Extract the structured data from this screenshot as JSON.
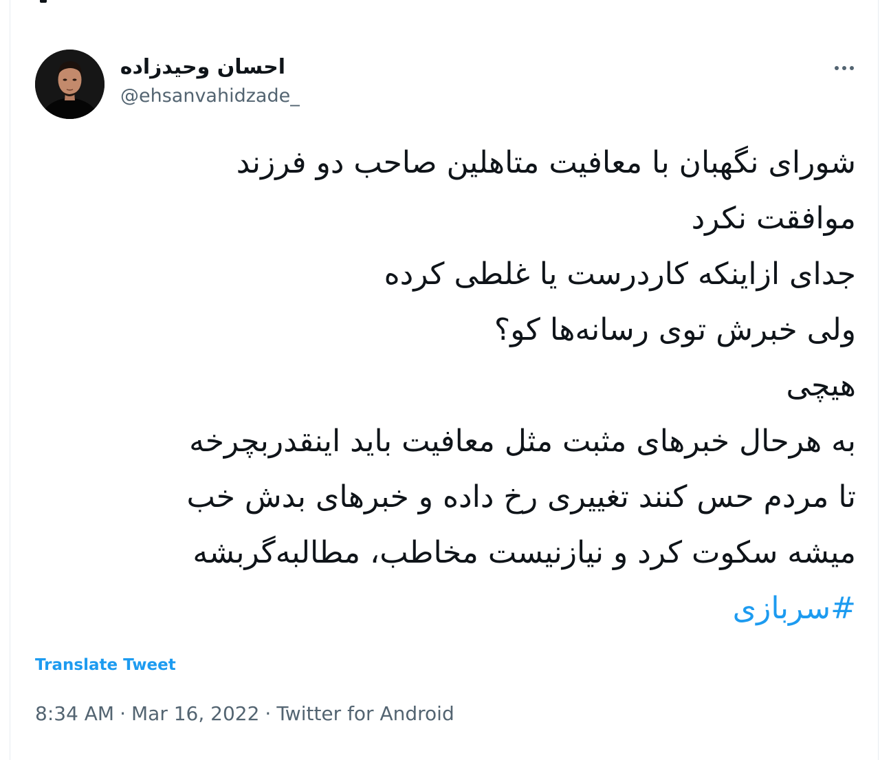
{
  "tweet": {
    "author": {
      "display_name": "احسان وحیدزاده",
      "handle": "@ehsanvahidzade_"
    },
    "more_icon": "more-horizontal-icon",
    "lines": [
      "شورای نگهبان با معافیت متاهلین صاحب دو فرزند",
      "موافقت نکرد",
      "جدای ازاینکه کاردرست یا غلطی کرده",
      "ولی خبرش توی رسانه‌ها کو؟",
      "هیچی",
      "به هرحال خبرهای مثبت مثل معافیت باید اینقدربچرخه",
      "تا مردم حس کنند تغییری رخ داده و خبرهای بدش خب",
      "میشه سکوت کرد و نیازنیست مخاطب، مطالبه‌گربشه"
    ],
    "hashtag": "#سربازی",
    "translate_label": "Translate Tweet",
    "time": "8:34 AM",
    "separator": "·",
    "date": "Mar 16, 2022",
    "source": "Twitter for Android"
  },
  "colors": {
    "text": "#0f1419",
    "secondary": "#536471",
    "link": "#1d9bf0"
  }
}
